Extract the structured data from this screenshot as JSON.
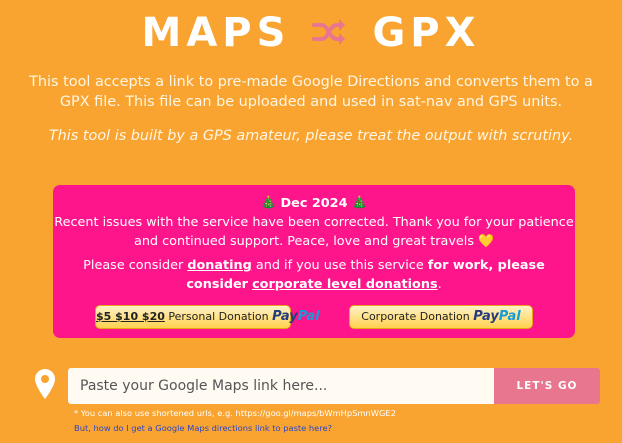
{
  "header": {
    "title_left": "MAPS",
    "title_right": "GPX",
    "shuffle_icon": "shuffle-icon",
    "shuffle_color": "#e8768f"
  },
  "intro": {
    "description": "This tool accepts a link to pre-made Google Directions and converts them to a GPX file. This file can be uploaded and used in sat-nav and GPS units.",
    "disclaimer": "This tool is built by a GPS amateur, please treat the output with scrutiny."
  },
  "notice": {
    "background": "#fe158b",
    "tree_emoji": "🎄",
    "date": "Dec 2024",
    "message": "Recent issues with the service have been corrected. Thank you for your patience and continued support. Peace, love and great travels",
    "heart": "💛",
    "consider_prefix": "Please consider",
    "donating_link": "donating",
    "consider_middle": "and if you use this service",
    "work_bold": "for work, please consider",
    "corporate_link": "corporate level donations",
    "period": ".",
    "personal_button": {
      "amounts": "$5 $10 $20",
      "label": "Personal Donation",
      "paypal_a": "Pay",
      "paypal_b": "Pal"
    },
    "corporate_button": {
      "label": "Corporate Donation",
      "paypal_a": "Pay",
      "paypal_b": "Pal"
    }
  },
  "search": {
    "placeholder": "Paste your Google Maps link here...",
    "value": "",
    "button_label": "LET'S GO",
    "pin_icon": "map-pin-icon",
    "hint": "* You can also use shortened urls, e.g. https://goo.gl/maps/bWmHpSmnWGE2",
    "help_link": "But, how do I get a Google Maps directions link to paste here?"
  }
}
